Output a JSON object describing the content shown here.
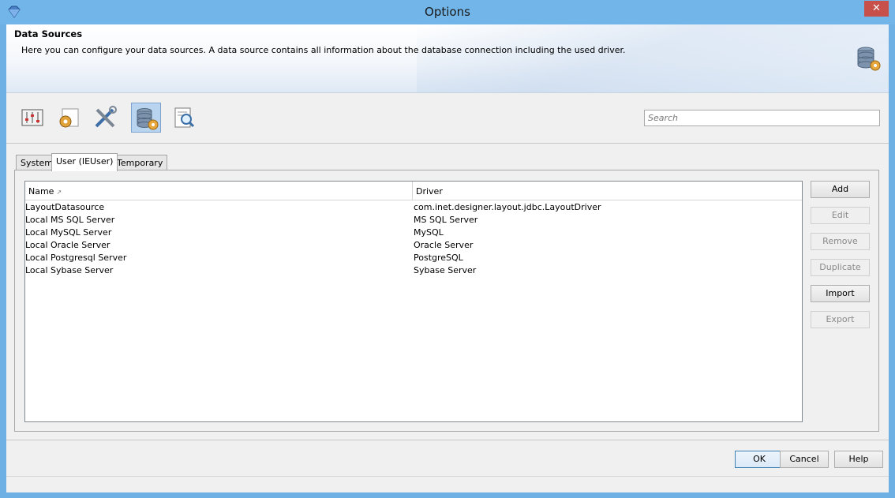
{
  "window": {
    "title": "Options",
    "close_glyph": "✕"
  },
  "header": {
    "title": "Data Sources",
    "description": "Here you can configure your data sources. A data source contains all information about the database connection including the used driver."
  },
  "toolbar": {
    "categories": [
      {
        "icon": "sliders-icon",
        "active": false
      },
      {
        "icon": "gear-folder-icon",
        "active": false
      },
      {
        "icon": "tools-icon",
        "active": false
      },
      {
        "icon": "database-gear-icon",
        "active": true
      },
      {
        "icon": "report-search-icon",
        "active": false
      }
    ],
    "search_placeholder": "Search"
  },
  "tabs": [
    {
      "label": "System",
      "active": false
    },
    {
      "label": "User (IEUser)",
      "active": true
    },
    {
      "label": "Temporary",
      "active": false
    }
  ],
  "table": {
    "columns": {
      "name": "Name",
      "driver": "Driver",
      "sort_indicator": "↗"
    },
    "rows": [
      {
        "name": "LayoutDatasource",
        "driver": "com.inet.designer.layout.jdbc.LayoutDriver"
      },
      {
        "name": "Local MS SQL Server",
        "driver": "MS SQL Server"
      },
      {
        "name": "Local MySQL Server",
        "driver": "MySQL"
      },
      {
        "name": "Local Oracle Server",
        "driver": "Oracle Server"
      },
      {
        "name": "Local Postgresql Server",
        "driver": "PostgreSQL"
      },
      {
        "name": "Local Sybase Server",
        "driver": "Sybase Server"
      }
    ]
  },
  "actions": {
    "add": "Add",
    "edit": "Edit",
    "remove": "Remove",
    "duplicate": "Duplicate",
    "import": "Import",
    "export": "Export"
  },
  "dialog": {
    "ok": "OK",
    "cancel": "Cancel",
    "help": "Help"
  }
}
